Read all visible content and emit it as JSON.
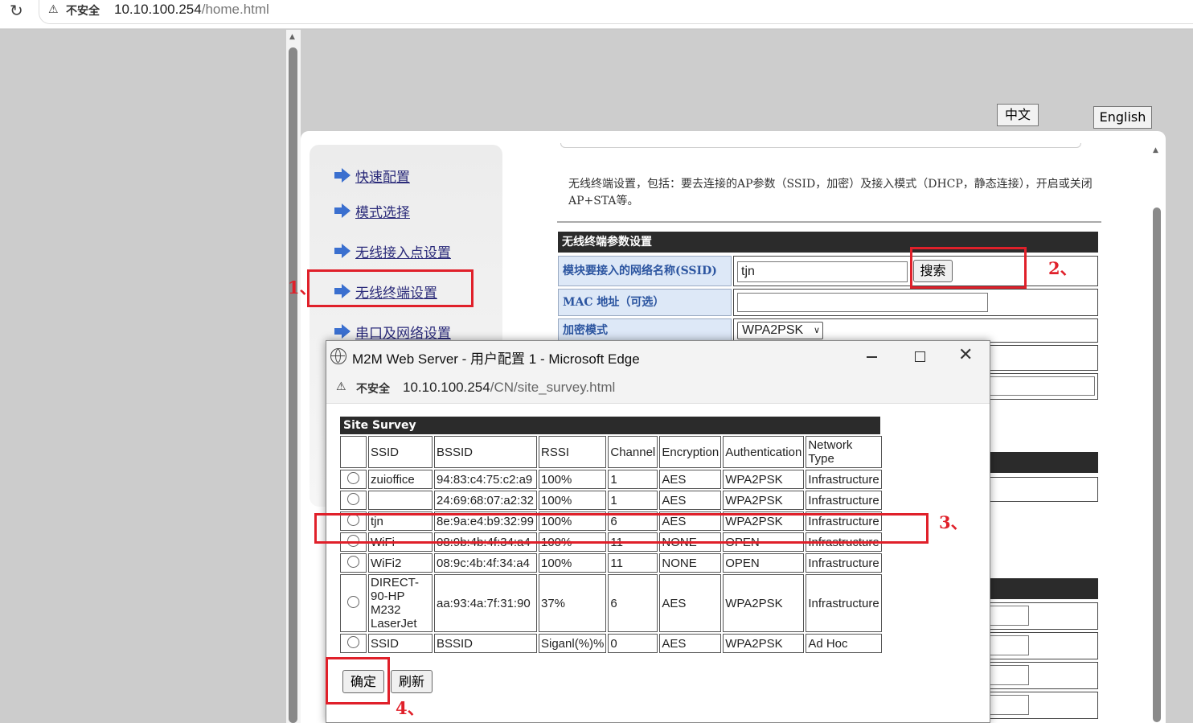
{
  "browser": {
    "insecure_label": "不安全",
    "url_host": "10.10.100.254",
    "url_path": "/home.html"
  },
  "lang_buttons": {
    "chinese": "中文",
    "english": "English"
  },
  "nav": {
    "items": [
      "快速配置",
      "模式选择",
      "无线接入点设置",
      "无线终端设置",
      "串口及网络设置"
    ]
  },
  "main": {
    "description": "无线终端设置，包括：要去连接的AP参数（SSID，加密）及接入模式（DHCP，静态连接），开启或关闭 AP+STA等。",
    "section_title": "无线终端参数设置",
    "ssid_label": "模块要接入的网络名称(SSID)",
    "ssid_value": "tjn",
    "search_button": "搜索",
    "mac_label": "MAC 地址（可选）",
    "mac_value": "",
    "encryption_label": "加密模式",
    "encryption_value": "WPA2PSK"
  },
  "annotations": [
    "1、",
    "2、",
    "3、",
    "4、"
  ],
  "popup": {
    "window_title": "M2M Web Server - 用户配置 1 - Microsoft Edge",
    "insecure_label": "不安全",
    "url_host": "10.10.100.254",
    "url_path": "/CN/site_survey.html",
    "survey_title": "Site Survey",
    "columns": [
      "SSID",
      "BSSID",
      "RSSI",
      "Channel",
      "Encryption",
      "Authentication",
      "Network Type"
    ],
    "rows": [
      {
        "ssid": "zuioffice",
        "bssid": "94:83:c4:75:c2:a9",
        "rssi": "100%",
        "channel": "1",
        "encryption": "AES",
        "auth": "WPA2PSK",
        "type": "Infrastructure"
      },
      {
        "ssid": "",
        "bssid": "24:69:68:07:a2:32",
        "rssi": "100%",
        "channel": "1",
        "encryption": "AES",
        "auth": "WPA2PSK",
        "type": "Infrastructure"
      },
      {
        "ssid": "tjn",
        "bssid": "8e:9a:e4:b9:32:99",
        "rssi": "100%",
        "channel": "6",
        "encryption": "AES",
        "auth": "WPA2PSK",
        "type": "Infrastructure"
      },
      {
        "ssid": "WiFi",
        "bssid": "08:9b:4b:4f:34:a4",
        "rssi": "100%",
        "channel": "11",
        "encryption": "NONE",
        "auth": "OPEN",
        "type": "Infrastructure"
      },
      {
        "ssid": "WiFi2",
        "bssid": "08:9c:4b:4f:34:a4",
        "rssi": "100%",
        "channel": "11",
        "encryption": "NONE",
        "auth": "OPEN",
        "type": "Infrastructure"
      },
      {
        "ssid": "DIRECT-90-HP M232 LaserJet",
        "bssid": "aa:93:4a:7f:31:90",
        "rssi": "37%",
        "channel": "6",
        "encryption": "AES",
        "auth": "WPA2PSK",
        "type": "Infrastructure"
      },
      {
        "ssid": "SSID",
        "bssid": "BSSID",
        "rssi": "Siganl(%)%",
        "channel": "0",
        "encryption": "AES",
        "auth": "WPA2PSK",
        "type": "Ad Hoc"
      }
    ],
    "confirm_button": "确定",
    "refresh_button": "刷新"
  }
}
